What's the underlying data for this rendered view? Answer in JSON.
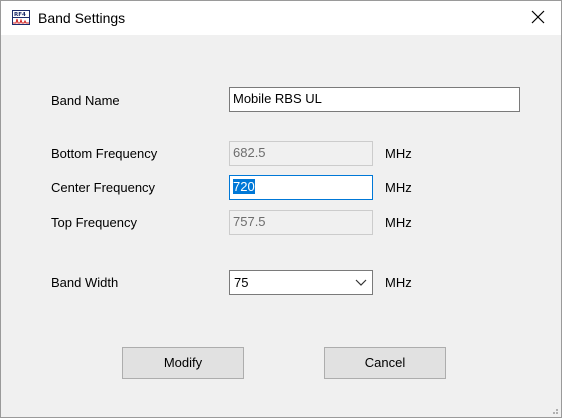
{
  "window": {
    "title": "Band Settings",
    "icon": "rf4-app-icon",
    "close_icon": "close-icon"
  },
  "form": {
    "band_name": {
      "label": "Band Name",
      "value": "Mobile RBS UL"
    },
    "bottom_frequency": {
      "label": "Bottom Frequency",
      "value": "682.5",
      "unit": "MHz",
      "enabled": false
    },
    "center_frequency": {
      "label": "Center Frequency",
      "value": "720",
      "unit": "MHz",
      "enabled": true,
      "text_selected": true
    },
    "top_frequency": {
      "label": "Top Frequency",
      "value": "757.5",
      "unit": "MHz",
      "enabled": false
    },
    "band_width": {
      "label": "Band Width",
      "value": "75",
      "unit": "MHz"
    }
  },
  "buttons": {
    "modify": "Modify",
    "cancel": "Cancel"
  },
  "colors": {
    "accent": "#0078d7",
    "dialog_background": "#f0f0f0",
    "button_face": "#e1e1e1"
  }
}
